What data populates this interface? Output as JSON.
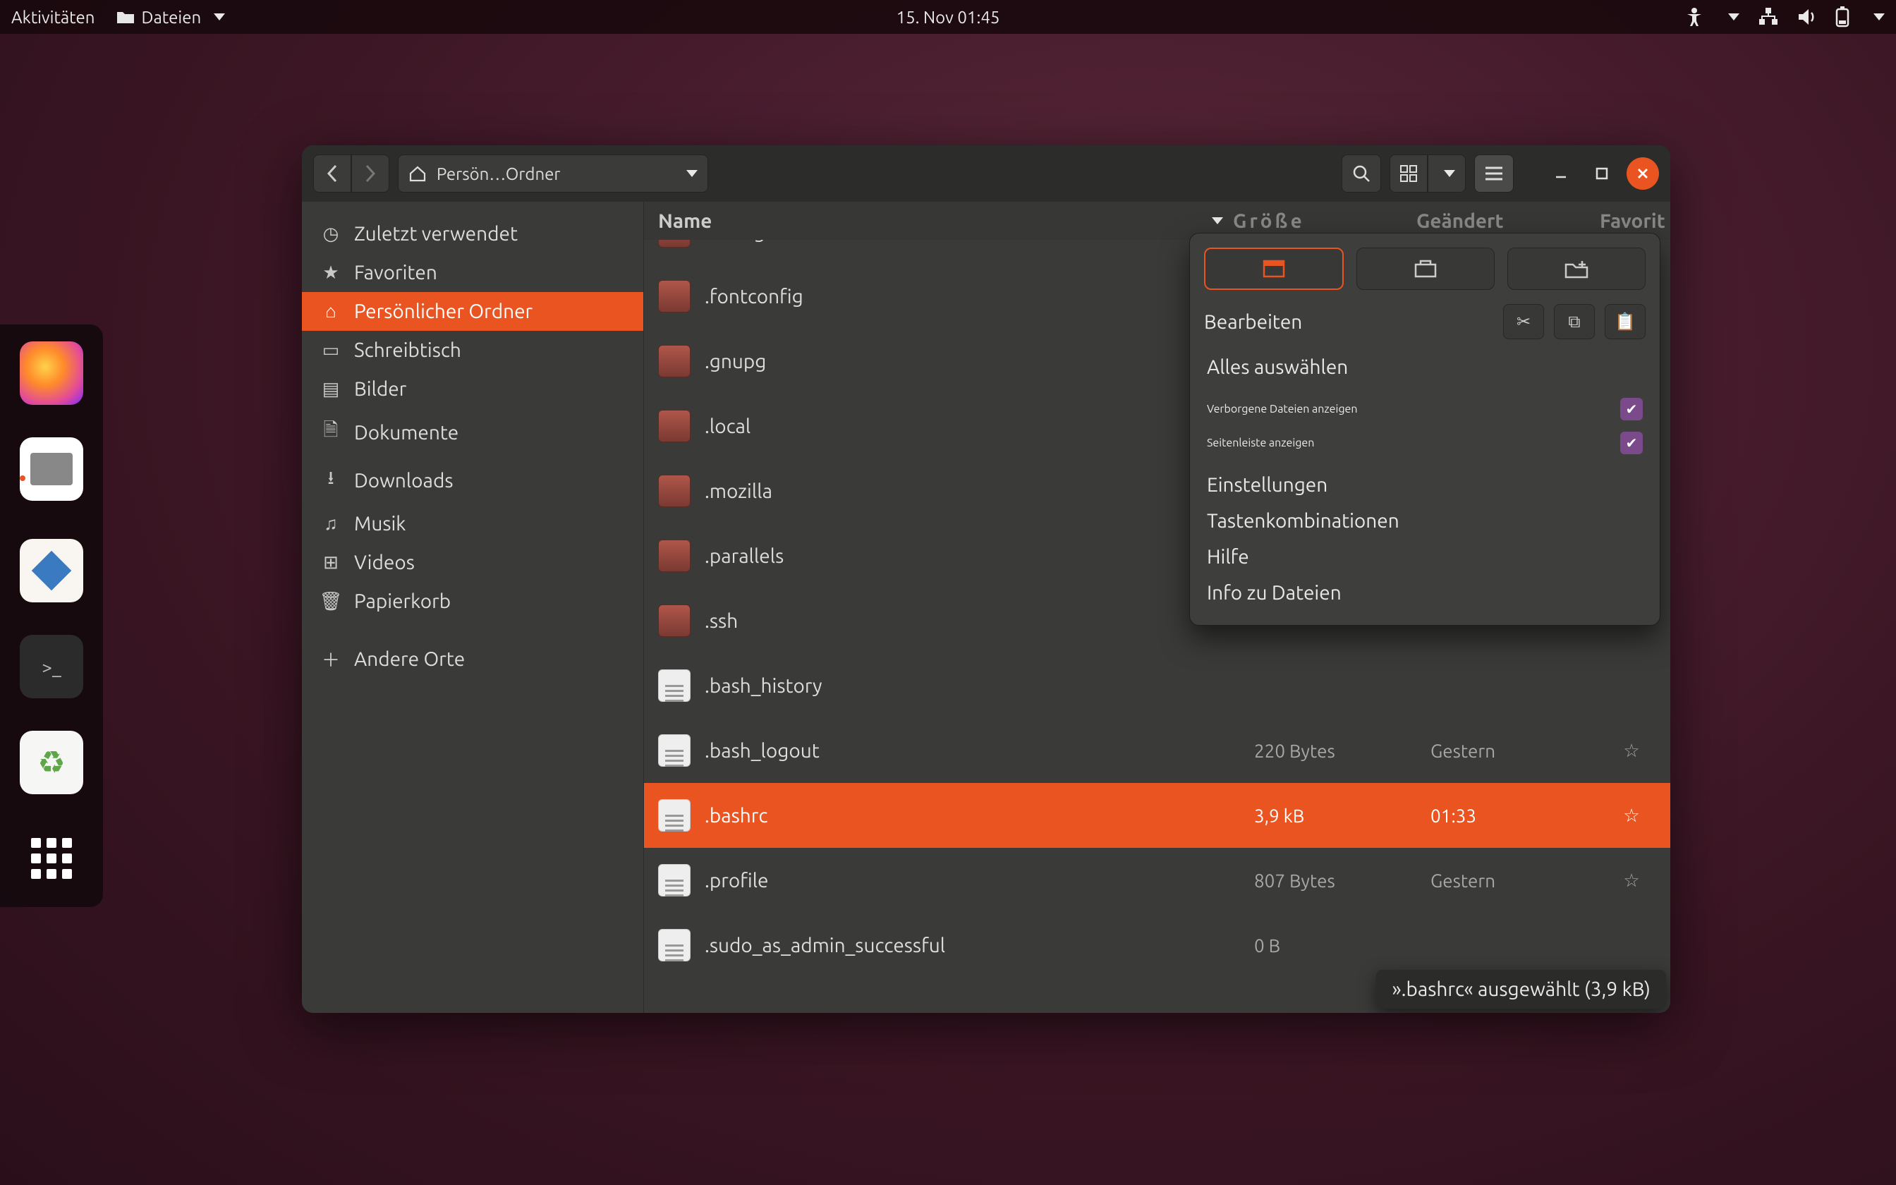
{
  "topbar": {
    "activities": "Aktivitäten",
    "app_name": "Dateien",
    "datetime": "15. Nov  01:45"
  },
  "dock": {
    "items": [
      "firefox",
      "files",
      "editor",
      "terminal",
      "trash",
      "apps"
    ]
  },
  "window": {
    "breadcrumb": "Persön…Ordner",
    "columns": {
      "name": "Name",
      "size": "Größe",
      "date": "Geändert",
      "fav": "Favorit"
    },
    "statusbar": "».bashrc« ausgewählt (3,9 kB)"
  },
  "sidebar": {
    "items": [
      {
        "icon": "clock",
        "label": "Zuletzt verwendet"
      },
      {
        "icon": "star",
        "label": "Favoriten"
      },
      {
        "icon": "home",
        "label": "Persönlicher Ordner",
        "active": true
      },
      {
        "icon": "desk",
        "label": "Schreibtisch"
      },
      {
        "icon": "image",
        "label": "Bilder"
      },
      {
        "icon": "doc",
        "label": "Dokumente"
      },
      {
        "icon": "down",
        "label": "Downloads"
      },
      {
        "icon": "music",
        "label": "Musik"
      },
      {
        "icon": "video",
        "label": "Videos"
      },
      {
        "icon": "trash",
        "label": "Papierkorb"
      },
      {
        "icon": "plus",
        "label": "Andere Orte"
      }
    ]
  },
  "files": [
    {
      "type": "folder",
      "name": ".config"
    },
    {
      "type": "folder",
      "name": ".fontconfig"
    },
    {
      "type": "folder",
      "name": ".gnupg"
    },
    {
      "type": "folder",
      "name": ".local"
    },
    {
      "type": "folder",
      "name": ".mozilla"
    },
    {
      "type": "folder",
      "name": ".parallels"
    },
    {
      "type": "folder",
      "name": ".ssh"
    },
    {
      "type": "file",
      "name": ".bash_history"
    },
    {
      "type": "file",
      "name": ".bash_logout",
      "size": "220 Bytes",
      "date": "Gestern",
      "fav": "☆"
    },
    {
      "type": "file",
      "name": ".bashrc",
      "size": "3,9 kB",
      "date": "01:33",
      "fav": "☆",
      "selected": true
    },
    {
      "type": "file",
      "name": ".profile",
      "size": "807 Bytes",
      "date": "Gestern",
      "fav": "☆"
    },
    {
      "type": "file",
      "name": ".sudo_as_admin_successful",
      "size": "0 B",
      "date": "",
      "fav": ""
    }
  ],
  "popover": {
    "edit": "Bearbeiten",
    "select_all": "Alles auswählen",
    "show_hidden": "Verborgene Dateien anzeigen",
    "show_sidebar": "Seitenleiste anzeigen",
    "settings": "Einstellungen",
    "shortcuts": "Tastenkombinationen",
    "help": "Hilfe",
    "about": "Info zu Dateien"
  }
}
